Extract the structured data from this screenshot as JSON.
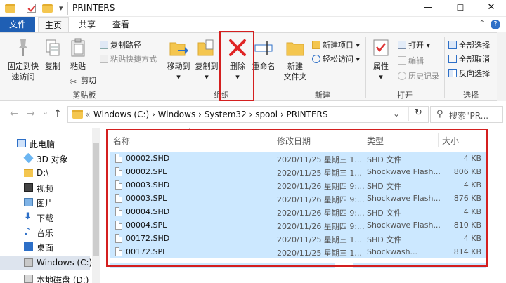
{
  "window": {
    "title": "PRINTERS",
    "minimize_glyph": "—",
    "maximize_glyph": "☐",
    "close_glyph": "✕",
    "quick_access_arrow": "▾"
  },
  "tabs": [
    {
      "label": "文件"
    },
    {
      "label": "主页"
    },
    {
      "label": "共享"
    },
    {
      "label": "查看"
    }
  ],
  "ribbon": {
    "clipboard": {
      "pin_label_1": "固定到快",
      "pin_label_2": "速访问",
      "copy": "复制",
      "paste": "粘贴",
      "copy_path": "复制路径",
      "paste_shortcut": "粘贴快捷方式",
      "cut": "剪切",
      "group": "剪贴板"
    },
    "organize": {
      "move_to": "移动到",
      "copy_to": "复制到",
      "delete": "删除",
      "rename": "重命名",
      "group": "组织"
    },
    "new": {
      "new_folder_1": "新建",
      "new_folder_2": "文件夹",
      "new_item": "新建项目",
      "easy_access": "轻松访问",
      "group": "新建"
    },
    "open": {
      "properties": "属性",
      "open": "打开",
      "edit": "编辑",
      "history": "历史记录",
      "group": "打开"
    },
    "select": {
      "select_all": "全部选择",
      "select_none": "全部取消",
      "invert": "反向选择",
      "group": "选择"
    },
    "dropdown_glyph": "▾"
  },
  "address": {
    "back": "←",
    "forward": "→",
    "up_menu": "⌄",
    "up": "↑",
    "chevrons": "«",
    "segments": [
      "Windows (C:)",
      "Windows",
      "System32",
      "spool",
      "PRINTERS"
    ],
    "separator": "›",
    "dropdown": "⌄",
    "refresh": "↻",
    "search_placeholder": "搜索\"PR..."
  },
  "nav": {
    "items": [
      {
        "label": "此电脑"
      },
      {
        "label": "3D 对象"
      },
      {
        "label": "D:\\"
      },
      {
        "label": "视频"
      },
      {
        "label": "图片"
      },
      {
        "label": "下载"
      },
      {
        "label": "音乐"
      },
      {
        "label": "桌面"
      },
      {
        "label": "Windows (C:)"
      },
      {
        "label": "本地磁盘 (D:)"
      }
    ]
  },
  "columns": {
    "name": "名称",
    "date": "修改日期",
    "type": "类型",
    "size": "大小",
    "sort_glyph": "^"
  },
  "files": [
    {
      "name": "00002.SHD",
      "date": "2020/11/25 星期三 1...",
      "type": "SHD 文件",
      "size": "4 KB"
    },
    {
      "name": "00002.SPL",
      "date": "2020/11/25 星期三 1...",
      "type": "Shockwave Flash...",
      "size": "806 KB"
    },
    {
      "name": "00003.SHD",
      "date": "2020/11/26 星期四 9:...",
      "type": "SHD 文件",
      "size": "4 KB"
    },
    {
      "name": "00003.SPL",
      "date": "2020/11/26 星期四 9:...",
      "type": "Shockwave Flash...",
      "size": "876 KB"
    },
    {
      "name": "00004.SHD",
      "date": "2020/11/26 星期四 9:...",
      "type": "SHD 文件",
      "size": "4 KB"
    },
    {
      "name": "00004.SPL",
      "date": "2020/11/26 星期四 9:...",
      "type": "Shockwave Flash...",
      "size": "810 KB"
    },
    {
      "name": "00172.SHD",
      "date": "2020/11/25 星期三 1...",
      "type": "SHD 文件",
      "size": "4 KB"
    },
    {
      "name": "00172.SPL",
      "date": "2020/11/25 星期三 1...",
      "type": "Shockwash...",
      "size": "814 KB"
    }
  ],
  "colors": {
    "accent": "#1f5fb4",
    "selection": "#cce8ff",
    "annotation": "#d41f1f",
    "delete_x": "#e02424"
  }
}
